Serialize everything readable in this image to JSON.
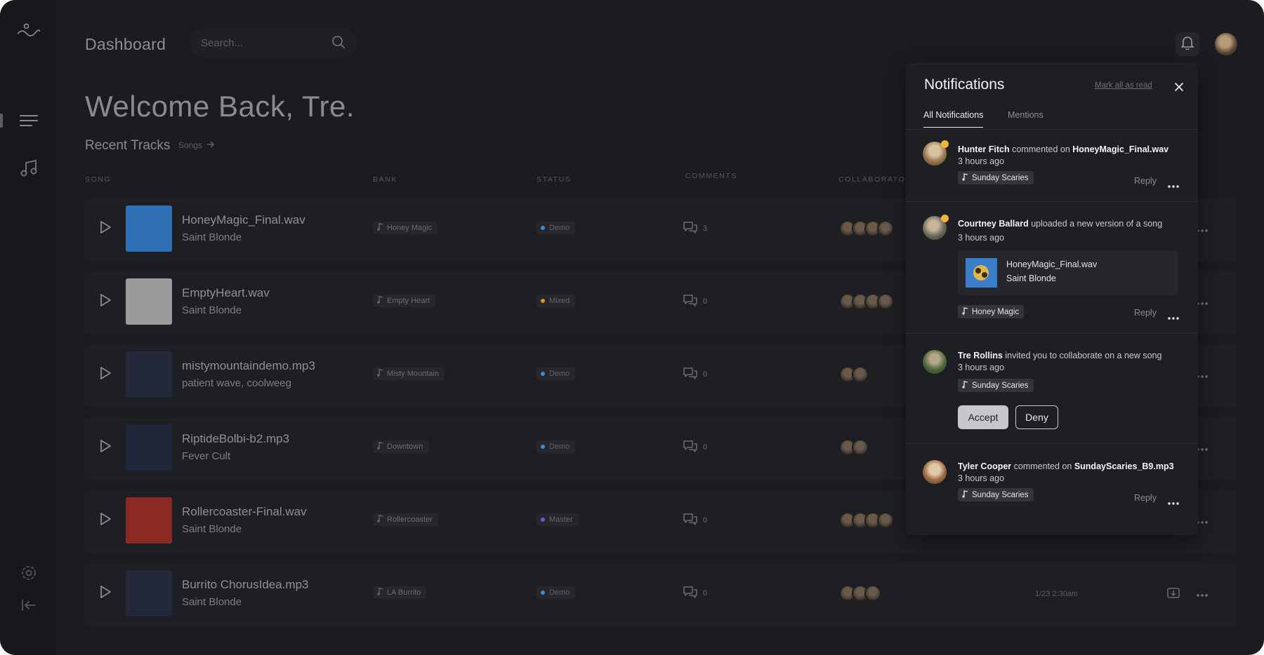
{
  "header": {
    "title": "Dashboard",
    "search_placeholder": "Search..."
  },
  "welcome": "Welcome Back, Tre.",
  "recent_tracks": {
    "title": "Recent Tracks",
    "songs_link": "Songs"
  },
  "table": {
    "columns": [
      "SONG",
      "BANK",
      "STATUS",
      "COMMENTS",
      "COLLABORATOR"
    ],
    "rows": [
      {
        "name": "HoneyMagic_Final.wav",
        "artist": "Saint Blonde",
        "bank": "Honey Magic",
        "status": "Demo",
        "status_color": "#3b8fd4",
        "comments": "3",
        "thumb_color": "#2f6fb5",
        "collaborators": 4
      },
      {
        "name": "EmptyHeart.wav",
        "artist": "Saint Blonde",
        "bank": "Empty Heart",
        "status": "Mixed",
        "status_color": "#d49a2e",
        "comments": "0",
        "thumb_color": "#9a9a9a",
        "collaborators": 4
      },
      {
        "name": "mistymountaindemo.mp3",
        "artist": "patient wave, coolweeg",
        "bank": "Misty Mountain",
        "status": "Demo",
        "status_color": "#3b8fd4",
        "comments": "0",
        "thumb_color": "#22283a",
        "collaborators": 2
      },
      {
        "name": "RiptideBolbi-b2.mp3",
        "artist": "Fever Cult",
        "bank": "Downtown",
        "status": "Demo",
        "status_color": "#3b8fd4",
        "comments": "0",
        "thumb_color": "#20263a",
        "collaborators": 2
      },
      {
        "name": "Rollercoaster-Final.wav",
        "artist": "Saint Blonde",
        "bank": "Rollercoaster",
        "status": "Master",
        "status_color": "#6a5acd",
        "comments": "0",
        "thumb_color": "#8a2a22",
        "collaborators": 4
      },
      {
        "name": "Burrito ChorusIdea.mp3",
        "artist": "Saint Blonde",
        "bank": "LA Burrito",
        "status": "Demo",
        "status_color": "#3b8fd4",
        "comments": "0",
        "thumb_color": "#22283a",
        "collaborators": 3,
        "date": "1/23 2:30am"
      }
    ]
  },
  "notifications": {
    "title": "Notifications",
    "mark_all": "Mark all as read",
    "tabs": [
      "All Notifications",
      "Mentions"
    ],
    "reply_label": "Reply",
    "items": [
      {
        "user": "Hunter Fitch",
        "action": "commented on",
        "target": "HoneyMagic_Final.wav",
        "time": "3 hours ago",
        "chip": "Sunday Scaries"
      },
      {
        "user": "Courtney Ballard",
        "action": "uploaded a new version of a song",
        "time": "3 hours ago",
        "file_name": "HoneyMagic_Final.wav",
        "file_artist": "Saint Blonde",
        "chip": "Honey Magic"
      },
      {
        "user": "Tre Rollins",
        "action": "invited you to collaborate on a new song",
        "time": "3 hours ago",
        "chip": "Sunday Scaries",
        "accept": "Accept",
        "deny": "Deny"
      },
      {
        "user": "Tyler Cooper",
        "action": "commented on",
        "target": "SundayScaries_B9.mp3",
        "time": "3 hours ago",
        "chip": "Sunday Scaries"
      }
    ]
  },
  "colors": {
    "background": "#1b1c20",
    "panel": "#1e1f23",
    "unread_badge": "#f0b43c"
  },
  "icons": [
    "logo-wave-icon",
    "menu-icon",
    "music-note-icon",
    "settings-icon",
    "collapse-icon",
    "search-icon",
    "bell-icon",
    "play-icon",
    "comment-icon",
    "more-icon",
    "close-icon",
    "export-icon"
  ]
}
